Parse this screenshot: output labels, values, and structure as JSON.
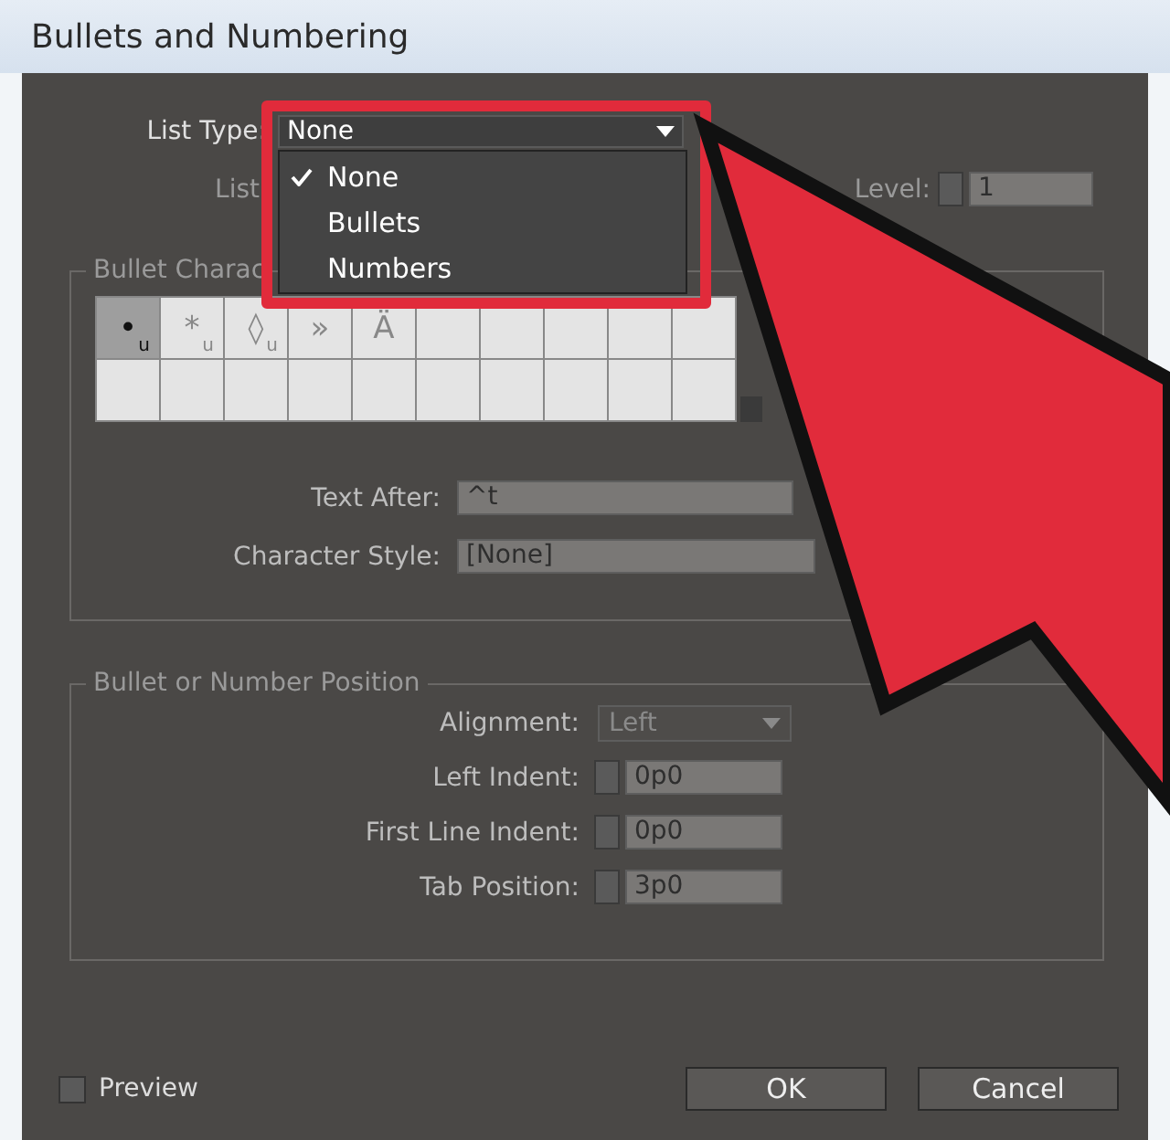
{
  "window": {
    "title": "Bullets and Numbering"
  },
  "list_type": {
    "label": "List Type:",
    "value": "None",
    "menu": [
      {
        "label": "None",
        "selected": true
      },
      {
        "label": "Bullets",
        "selected": false
      },
      {
        "label": "Numbers",
        "selected": false
      }
    ]
  },
  "list": {
    "label": "List"
  },
  "level": {
    "label": "Level:",
    "value": "1"
  },
  "bullet_character": {
    "title": "Bullet Charac",
    "cells": [
      {
        "glyph": "•",
        "mark": "u",
        "selected": true
      },
      {
        "glyph": "*",
        "mark": "u",
        "selected": false
      },
      {
        "glyph": "◊",
        "mark": "u",
        "selected": false
      },
      {
        "glyph": "»",
        "selected": false
      },
      {
        "glyph": "Ä",
        "selected": false
      }
    ],
    "text_after": {
      "label": "Text After:",
      "value": "^t"
    },
    "character_style": {
      "label": "Character Style:",
      "value": "[None]"
    }
  },
  "position": {
    "title": "Bullet or Number Position",
    "alignment": {
      "label": "Alignment:",
      "value": "Left"
    },
    "fields": [
      {
        "label": "Left Indent:",
        "value": "0p0"
      },
      {
        "label": "First Line Indent:",
        "value": "0p0"
      },
      {
        "label": "Tab Position:",
        "value": "3p0"
      }
    ]
  },
  "preview": {
    "label": "Preview",
    "checked": false
  },
  "buttons": [
    "OK",
    "Cancel"
  ]
}
